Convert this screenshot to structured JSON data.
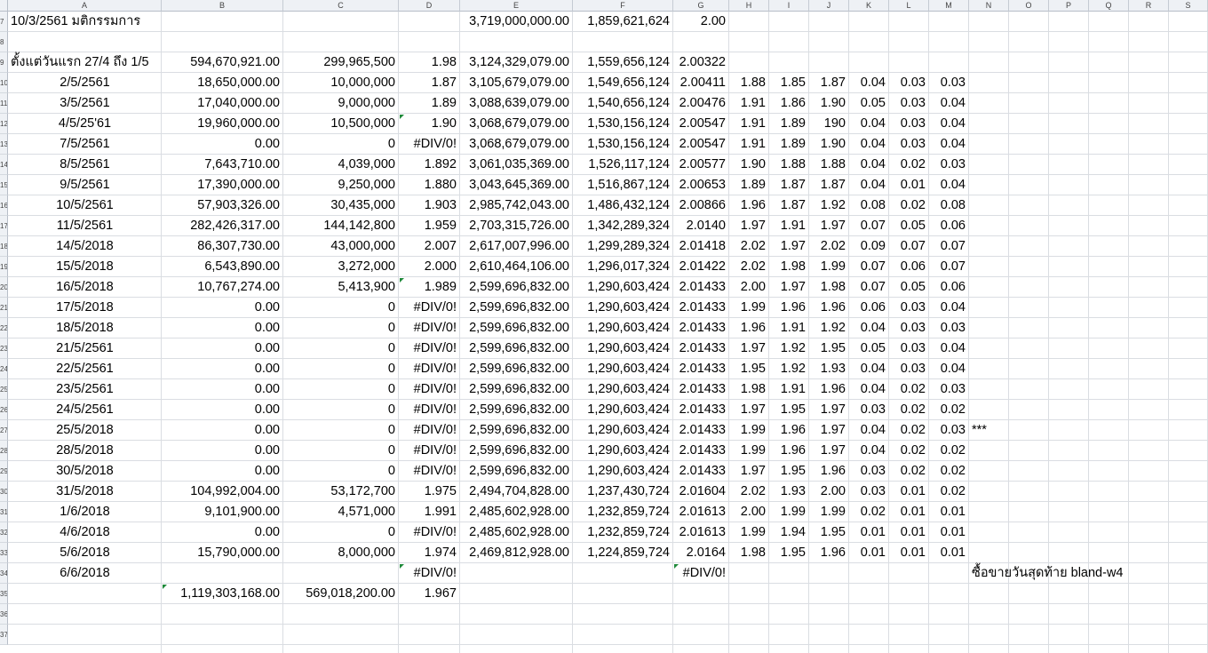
{
  "columns": [
    "A",
    "B",
    "C",
    "D",
    "E",
    "F",
    "G",
    "H",
    "I",
    "J",
    "K",
    "L",
    "M",
    "N",
    "O",
    "P",
    "Q",
    "R",
    "S"
  ],
  "row_numbers": [
    "7",
    "8",
    "9",
    "10",
    "11",
    "12",
    "13",
    "14",
    "15",
    "16",
    "17",
    "18",
    "19",
    "20",
    "21",
    "22",
    "23",
    "24",
    "25",
    "26",
    "27",
    "28",
    "29",
    "30",
    "31",
    "32",
    "33",
    "34",
    "35",
    "36",
    "37"
  ],
  "rows": [
    {
      "A": "10/3/2561 มติกรรมการ",
      "E": "3,719,000,000.00",
      "F": "1,859,621,624",
      "G": "2.00"
    },
    {},
    {
      "A": "ตั้งแต่วันแรก 27/4 ถึง 1/5",
      "B": "594,670,921.00",
      "C": "299,965,500",
      "D": "1.98",
      "E": "3,124,329,079.00",
      "F": "1,559,656,124",
      "G": "2.00322"
    },
    {
      "A": "2/5/2561",
      "B": "18,650,000.00",
      "C": "10,000,000",
      "D": "1.87",
      "E": "3,105,679,079.00",
      "F": "1,549,656,124",
      "G": "2.00411",
      "H": "1.88",
      "I": "1.85",
      "J": "1.87",
      "K": "0.04",
      "L": "0.03",
      "M": "0.03"
    },
    {
      "A": "3/5/2561",
      "B": "17,040,000.00",
      "C": "9,000,000",
      "D": "1.89",
      "E": "3,088,639,079.00",
      "F": "1,540,656,124",
      "G": "2.00476",
      "H": "1.91",
      "I": "1.86",
      "J": "1.90",
      "K": "0.05",
      "L": "0.03",
      "M": "0.04"
    },
    {
      "A": "4/5/25'61",
      "B": "19,960,000.00",
      "C": "10,500,000",
      "D": "1.90",
      "E": "3,068,679,079.00",
      "F": "1,530,156,124",
      "G": "2.00547",
      "H": "1.91",
      "I": "1.89",
      "J": "190",
      "K": "0.04",
      "L": "0.03",
      "M": "0.04"
    },
    {
      "A": "7/5/2561",
      "B": "0.00",
      "C": "0",
      "D": "#DIV/0!",
      "E": "3,068,679,079.00",
      "F": "1,530,156,124",
      "G": "2.00547",
      "H": "1.91",
      "I": "1.89",
      "J": "1.90",
      "K": "0.04",
      "L": "0.03",
      "M": "0.04"
    },
    {
      "A": "8/5/2561",
      "B": "7,643,710.00",
      "C": "4,039,000",
      "D": "1.892",
      "E": "3,061,035,369.00",
      "F": "1,526,117,124",
      "G": "2.00577",
      "H": "1.90",
      "I": "1.88",
      "J": "1.88",
      "K": "0.04",
      "L": "0.02",
      "M": "0.03"
    },
    {
      "A": "9/5/2561",
      "B": "17,390,000.00",
      "C": "9,250,000",
      "D": "1.880",
      "E": "3,043,645,369.00",
      "F": "1,516,867,124",
      "G": "2.00653",
      "H": "1.89",
      "I": "1.87",
      "J": "1.87",
      "K": "0.04",
      "L": "0.01",
      "M": "0.04"
    },
    {
      "A": "10/5/2561",
      "B": "57,903,326.00",
      "C": "30,435,000",
      "D": "1.903",
      "E": "2,985,742,043.00",
      "F": "1,486,432,124",
      "G": "2.00866",
      "H": "1.96",
      "I": "1.87",
      "J": "1.92",
      "K": "0.08",
      "L": "0.02",
      "M": "0.08"
    },
    {
      "A": "11/5/2561",
      "B": "282,426,317.00",
      "C": "144,142,800",
      "D": "1.959",
      "E": "2,703,315,726.00",
      "F": "1,342,289,324",
      "G": "2.0140",
      "H": "1.97",
      "I": "1.91",
      "J": "1.97",
      "K": "0.07",
      "L": "0.05",
      "M": "0.06"
    },
    {
      "A": "14/5/2018",
      "B": "86,307,730.00",
      "C": "43,000,000",
      "D": "2.007",
      "E": "2,617,007,996.00",
      "F": "1,299,289,324",
      "G": "2.01418",
      "H": "2.02",
      "I": "1.97",
      "J": "2.02",
      "K": "0.09",
      "L": "0.07",
      "M": "0.07"
    },
    {
      "A": "15/5/2018",
      "B": "6,543,890.00",
      "C": "3,272,000",
      "D": "2.000",
      "E": "2,610,464,106.00",
      "F": "1,296,017,324",
      "G": "2.01422",
      "H": "2.02",
      "I": "1.98",
      "J": "1.99",
      "K": "0.07",
      "L": "0.06",
      "M": "0.07"
    },
    {
      "A": "16/5/2018",
      "B": "10,767,274.00",
      "C": "5,413,900",
      "D": "1.989",
      "E": "2,599,696,832.00",
      "F": "1,290,603,424",
      "G": "2.01433",
      "H": "2.00",
      "I": "1.97",
      "J": "1.98",
      "K": "0.07",
      "L": "0.05",
      "M": "0.06"
    },
    {
      "A": "17/5/2018",
      "B": "0.00",
      "C": "0",
      "D": "#DIV/0!",
      "E": "2,599,696,832.00",
      "F": "1,290,603,424",
      "G": "2.01433",
      "H": "1.99",
      "I": "1.96",
      "J": "1.96",
      "K": "0.06",
      "L": "0.03",
      "M": "0.04"
    },
    {
      "A": "18/5/2018",
      "B": "0.00",
      "C": "0",
      "D": "#DIV/0!",
      "E": "2,599,696,832.00",
      "F": "1,290,603,424",
      "G": "2.01433",
      "H": "1.96",
      "I": "1.91",
      "J": "1.92",
      "K": "0.04",
      "L": "0.03",
      "M": "0.03"
    },
    {
      "A": "21/5/2561",
      "B": "0.00",
      "C": "0",
      "D": "#DIV/0!",
      "E": "2,599,696,832.00",
      "F": "1,290,603,424",
      "G": "2.01433",
      "H": "1.97",
      "I": "1.92",
      "J": "1.95",
      "K": "0.05",
      "L": "0.03",
      "M": "0.04"
    },
    {
      "A": "22/5/2561",
      "B": "0.00",
      "C": "0",
      "D": "#DIV/0!",
      "E": "2,599,696,832.00",
      "F": "1,290,603,424",
      "G": "2.01433",
      "H": "1.95",
      "I": "1.92",
      "J": "1.93",
      "K": "0.04",
      "L": "0.03",
      "M": "0.04"
    },
    {
      "A": "23/5/2561",
      "B": "0.00",
      "C": "0",
      "D": "#DIV/0!",
      "E": "2,599,696,832.00",
      "F": "1,290,603,424",
      "G": "2.01433",
      "H": "1.98",
      "I": "1.91",
      "J": "1.96",
      "K": "0.04",
      "L": "0.02",
      "M": "0.03"
    },
    {
      "A": "24/5/2561",
      "B": "0.00",
      "C": "0",
      "D": "#DIV/0!",
      "E": "2,599,696,832.00",
      "F": "1,290,603,424",
      "G": "2.01433",
      "H": "1.97",
      "I": "1.95",
      "J": "1.97",
      "K": "0.03",
      "L": "0.02",
      "M": "0.02"
    },
    {
      "A": "25/5/2018",
      "B": "0.00",
      "C": "0",
      "D": "#DIV/0!",
      "E": "2,599,696,832.00",
      "F": "1,290,603,424",
      "G": "2.01433",
      "H": "1.99",
      "I": "1.96",
      "J": "1.97",
      "K": "0.04",
      "L": "0.02",
      "M": "0.03",
      "N": "***"
    },
    {
      "A": "28/5/2018",
      "B": "0.00",
      "C": "0",
      "D": "#DIV/0!",
      "E": "2,599,696,832.00",
      "F": "1,290,603,424",
      "G": "2.01433",
      "H": "1.99",
      "I": "1.96",
      "J": "1.97",
      "K": "0.04",
      "L": "0.02",
      "M": "0.02"
    },
    {
      "A": "30/5/2018",
      "B": "0.00",
      "C": "0",
      "D": "#DIV/0!",
      "E": "2,599,696,832.00",
      "F": "1,290,603,424",
      "G": "2.01433",
      "H": "1.97",
      "I": "1.95",
      "J": "1.96",
      "K": "0.03",
      "L": "0.02",
      "M": "0.02"
    },
    {
      "A": "31/5/2018",
      "B": "104,992,004.00",
      "C": "53,172,700",
      "D": "1.975",
      "E": "2,494,704,828.00",
      "F": "1,237,430,724",
      "G": "2.01604",
      "H": "2.02",
      "I": "1.93",
      "J": "2.00",
      "K": "0.03",
      "L": "0.01",
      "M": "0.02"
    },
    {
      "A": "1/6/2018",
      "B": "9,101,900.00",
      "C": "4,571,000",
      "D": "1.991",
      "E": "2,485,602,928.00",
      "F": "1,232,859,724",
      "G": "2.01613",
      "H": "2.00",
      "I": "1.99",
      "J": "1.99",
      "K": "0.02",
      "L": "0.01",
      "M": "0.01"
    },
    {
      "A": "4/6/2018",
      "B": "0.00",
      "C": "0",
      "D": "#DIV/0!",
      "E": "2,485,602,928.00",
      "F": "1,232,859,724",
      "G": "2.01613",
      "H": "1.99",
      "I": "1.94",
      "J": "1.95",
      "K": "0.01",
      "L": "0.01",
      "M": "0.01"
    },
    {
      "A": "5/6/2018",
      "B": "15,790,000.00",
      "C": "8,000,000",
      "D": "1.974",
      "E": "2,469,812,928.00",
      "F": "1,224,859,724",
      "G": "2.0164",
      "H": "1.98",
      "I": "1.95",
      "J": "1.96",
      "K": "0.01",
      "L": "0.01",
      "M": "0.01"
    },
    {
      "A": "6/6/2018",
      "D": "#DIV/0!",
      "G": "#DIV/0!",
      "N": "ซื้อขายวันสุดท้าย bland-w4"
    },
    {
      "B": "1,119,303,168.00",
      "C": "569,018,200.00",
      "D": "1.967"
    },
    {},
    {}
  ]
}
